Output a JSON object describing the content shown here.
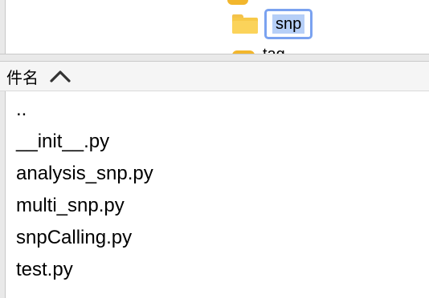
{
  "tree": {
    "selected_folder": "snp",
    "next_folder_partial": "tag"
  },
  "file_list": {
    "column_header": "件名",
    "sort_direction": "ascending",
    "files": [
      "..",
      "__init__.py",
      "analysis_snp.py",
      "multi_snp.py",
      "snpCalling.py",
      "test.py"
    ]
  },
  "colors": {
    "folder": "#f7c948",
    "selection_border": "#7aa2f0",
    "selection_fill": "#b6cff7"
  }
}
